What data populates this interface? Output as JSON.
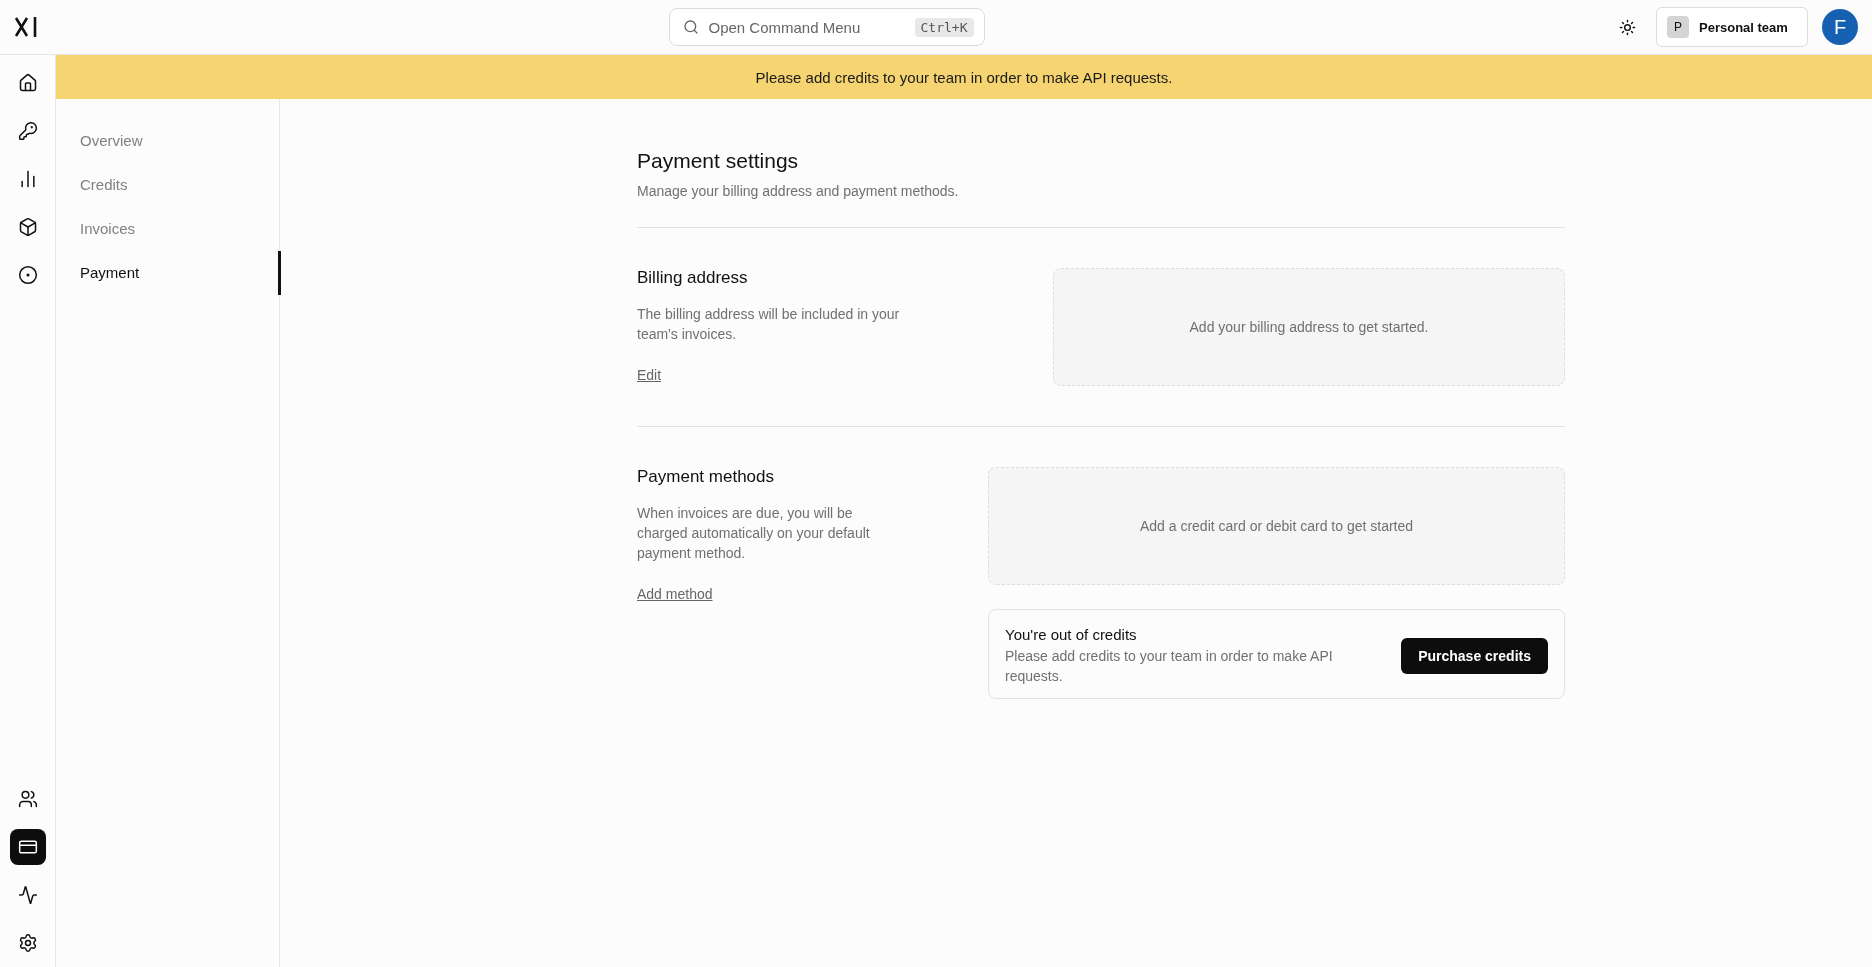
{
  "topbar": {
    "command_menu": {
      "placeholder": "Open Command Menu",
      "shortcut": "Ctrl+K"
    },
    "team": {
      "initial": "P",
      "name": "Personal team"
    },
    "avatar": "F"
  },
  "rail": {
    "top": [
      {
        "selected": false
      },
      {
        "selected": false
      },
      {
        "selected": false
      },
      {
        "selected": false
      },
      {
        "selected": false
      }
    ],
    "bottom": [
      {
        "selected": false
      },
      {
        "selected": true
      },
      {
        "selected": false
      },
      {
        "selected": false
      }
    ]
  },
  "banner": "Please add credits to your team in order to make API requests.",
  "nav": [
    {
      "label": "Overview",
      "selected": false
    },
    {
      "label": "Credits",
      "selected": false
    },
    {
      "label": "Invoices",
      "selected": false
    },
    {
      "label": "Payment",
      "selected": true
    }
  ],
  "page": {
    "title": "Payment settings",
    "subtitle": "Manage your billing address and payment methods."
  },
  "sections": [
    {
      "title": "Billing address",
      "description": "The billing address will be included in your team's invoices.",
      "link": "Edit",
      "empty_text": "Add your billing address to get started."
    },
    {
      "title": "Payment methods",
      "description": "When invoices are due, you will be charged automatically on your default payment method.",
      "link": "Add method",
      "empty_text": "Add a credit card or debit card to get started"
    }
  ],
  "credits_notice": {
    "title": "You're out of credits",
    "message": "Please add credits to your team in order to make API requests.",
    "button": "Purchase credits"
  }
}
